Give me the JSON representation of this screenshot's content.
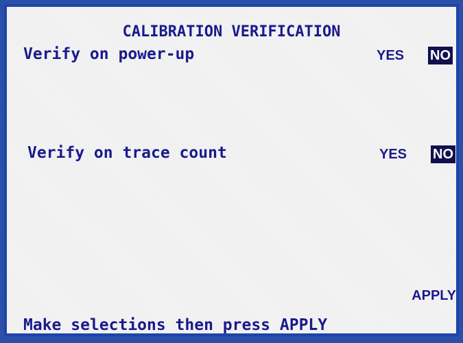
{
  "screen": {
    "title": "CALIBRATION VERIFICATION",
    "rows": [
      {
        "label": "Verify on power-up",
        "yes_label": "YES",
        "no_label": "NO",
        "selected": "NO"
      },
      {
        "label": "Verify on trace count",
        "yes_label": "YES",
        "no_label": "NO",
        "selected": "NO"
      }
    ],
    "apply_label": "APPLY",
    "hint": "Make selections then press APPLY"
  },
  "colors": {
    "frame": "#1f44a8",
    "text": "#1a1a8c",
    "selected_bg": "#10104e",
    "selected_text": "#ffffff",
    "background": "#f4f4f4"
  }
}
